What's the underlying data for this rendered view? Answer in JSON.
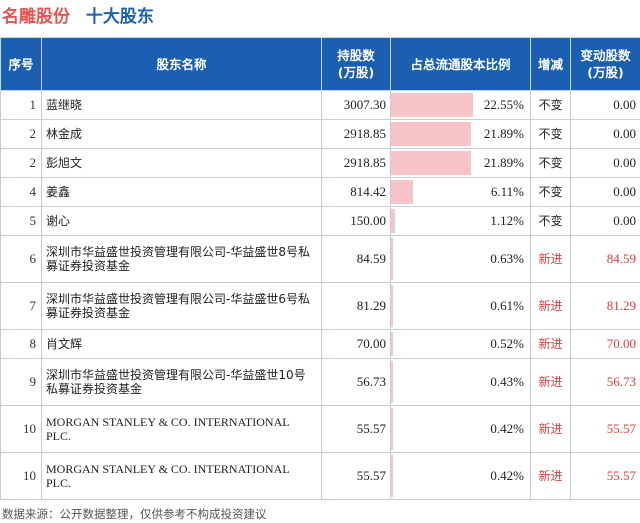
{
  "header": {
    "company": "名雕股份",
    "subtitle": "十大股东"
  },
  "columns": {
    "index": "序号",
    "name": "股东名称",
    "shares_line1": "持股数",
    "shares_line2": "(万股)",
    "ratio": "占总流通股本比例",
    "change": "增减",
    "delta_line1": "变动股数",
    "delta_line2": "(万股)"
  },
  "rows": [
    {
      "index": "1",
      "name": "蓝继晓",
      "shares": "3007.30",
      "ratio": "22.55%",
      "ratio_value": 22.55,
      "change": "不变",
      "delta": "0.00"
    },
    {
      "index": "2",
      "name": "林金成",
      "shares": "2918.85",
      "ratio": "21.89%",
      "ratio_value": 21.89,
      "change": "不变",
      "delta": "0.00"
    },
    {
      "index": "2",
      "name": "彭旭文",
      "shares": "2918.85",
      "ratio": "21.89%",
      "ratio_value": 21.89,
      "change": "不变",
      "delta": "0.00"
    },
    {
      "index": "4",
      "name": "姜鑫",
      "shares": "814.42",
      "ratio": "6.11%",
      "ratio_value": 6.11,
      "change": "不变",
      "delta": "0.00"
    },
    {
      "index": "5",
      "name": "谢心",
      "shares": "150.00",
      "ratio": "1.12%",
      "ratio_value": 1.12,
      "change": "不变",
      "delta": "0.00"
    },
    {
      "index": "6",
      "name": "深圳市华益盛世投资管理有限公司-华益盛世8号私募证券投资基金",
      "shares": "84.59",
      "ratio": "0.63%",
      "ratio_value": 0.63,
      "change": "新进",
      "delta": "84.59"
    },
    {
      "index": "7",
      "name": "深圳市华益盛世投资管理有限公司-华益盛世6号私募证券投资基金",
      "shares": "81.29",
      "ratio": "0.61%",
      "ratio_value": 0.61,
      "change": "新进",
      "delta": "81.29"
    },
    {
      "index": "8",
      "name": "肖文辉",
      "shares": "70.00",
      "ratio": "0.52%",
      "ratio_value": 0.52,
      "change": "新进",
      "delta": "70.00"
    },
    {
      "index": "9",
      "name": "深圳市华益盛世投资管理有限公司-华益盛世10号私募证券投资基金",
      "shares": "56.73",
      "ratio": "0.43%",
      "ratio_value": 0.43,
      "change": "新进",
      "delta": "56.73"
    },
    {
      "index": "10",
      "name": "MORGAN STANLEY & CO. INTERNATIONAL PLC.",
      "shares": "55.57",
      "ratio": "0.42%",
      "ratio_value": 0.42,
      "change": "新进",
      "delta": "55.57"
    },
    {
      "index": "10",
      "name": "MORGAN STANLEY & CO. INTERNATIONAL PLC.",
      "shares": "55.57",
      "ratio": "0.42%",
      "ratio_value": 0.42,
      "change": "新进",
      "delta": "55.57"
    }
  ],
  "colors": {
    "header_bg": "#1a5fb0",
    "bar": "#f7c4c8",
    "new_text": "#e03c3c",
    "company_title": "#e8514f"
  },
  "footer": {
    "source": "数据来源：公开数据整理，仅供参考不构成投资建议"
  }
}
